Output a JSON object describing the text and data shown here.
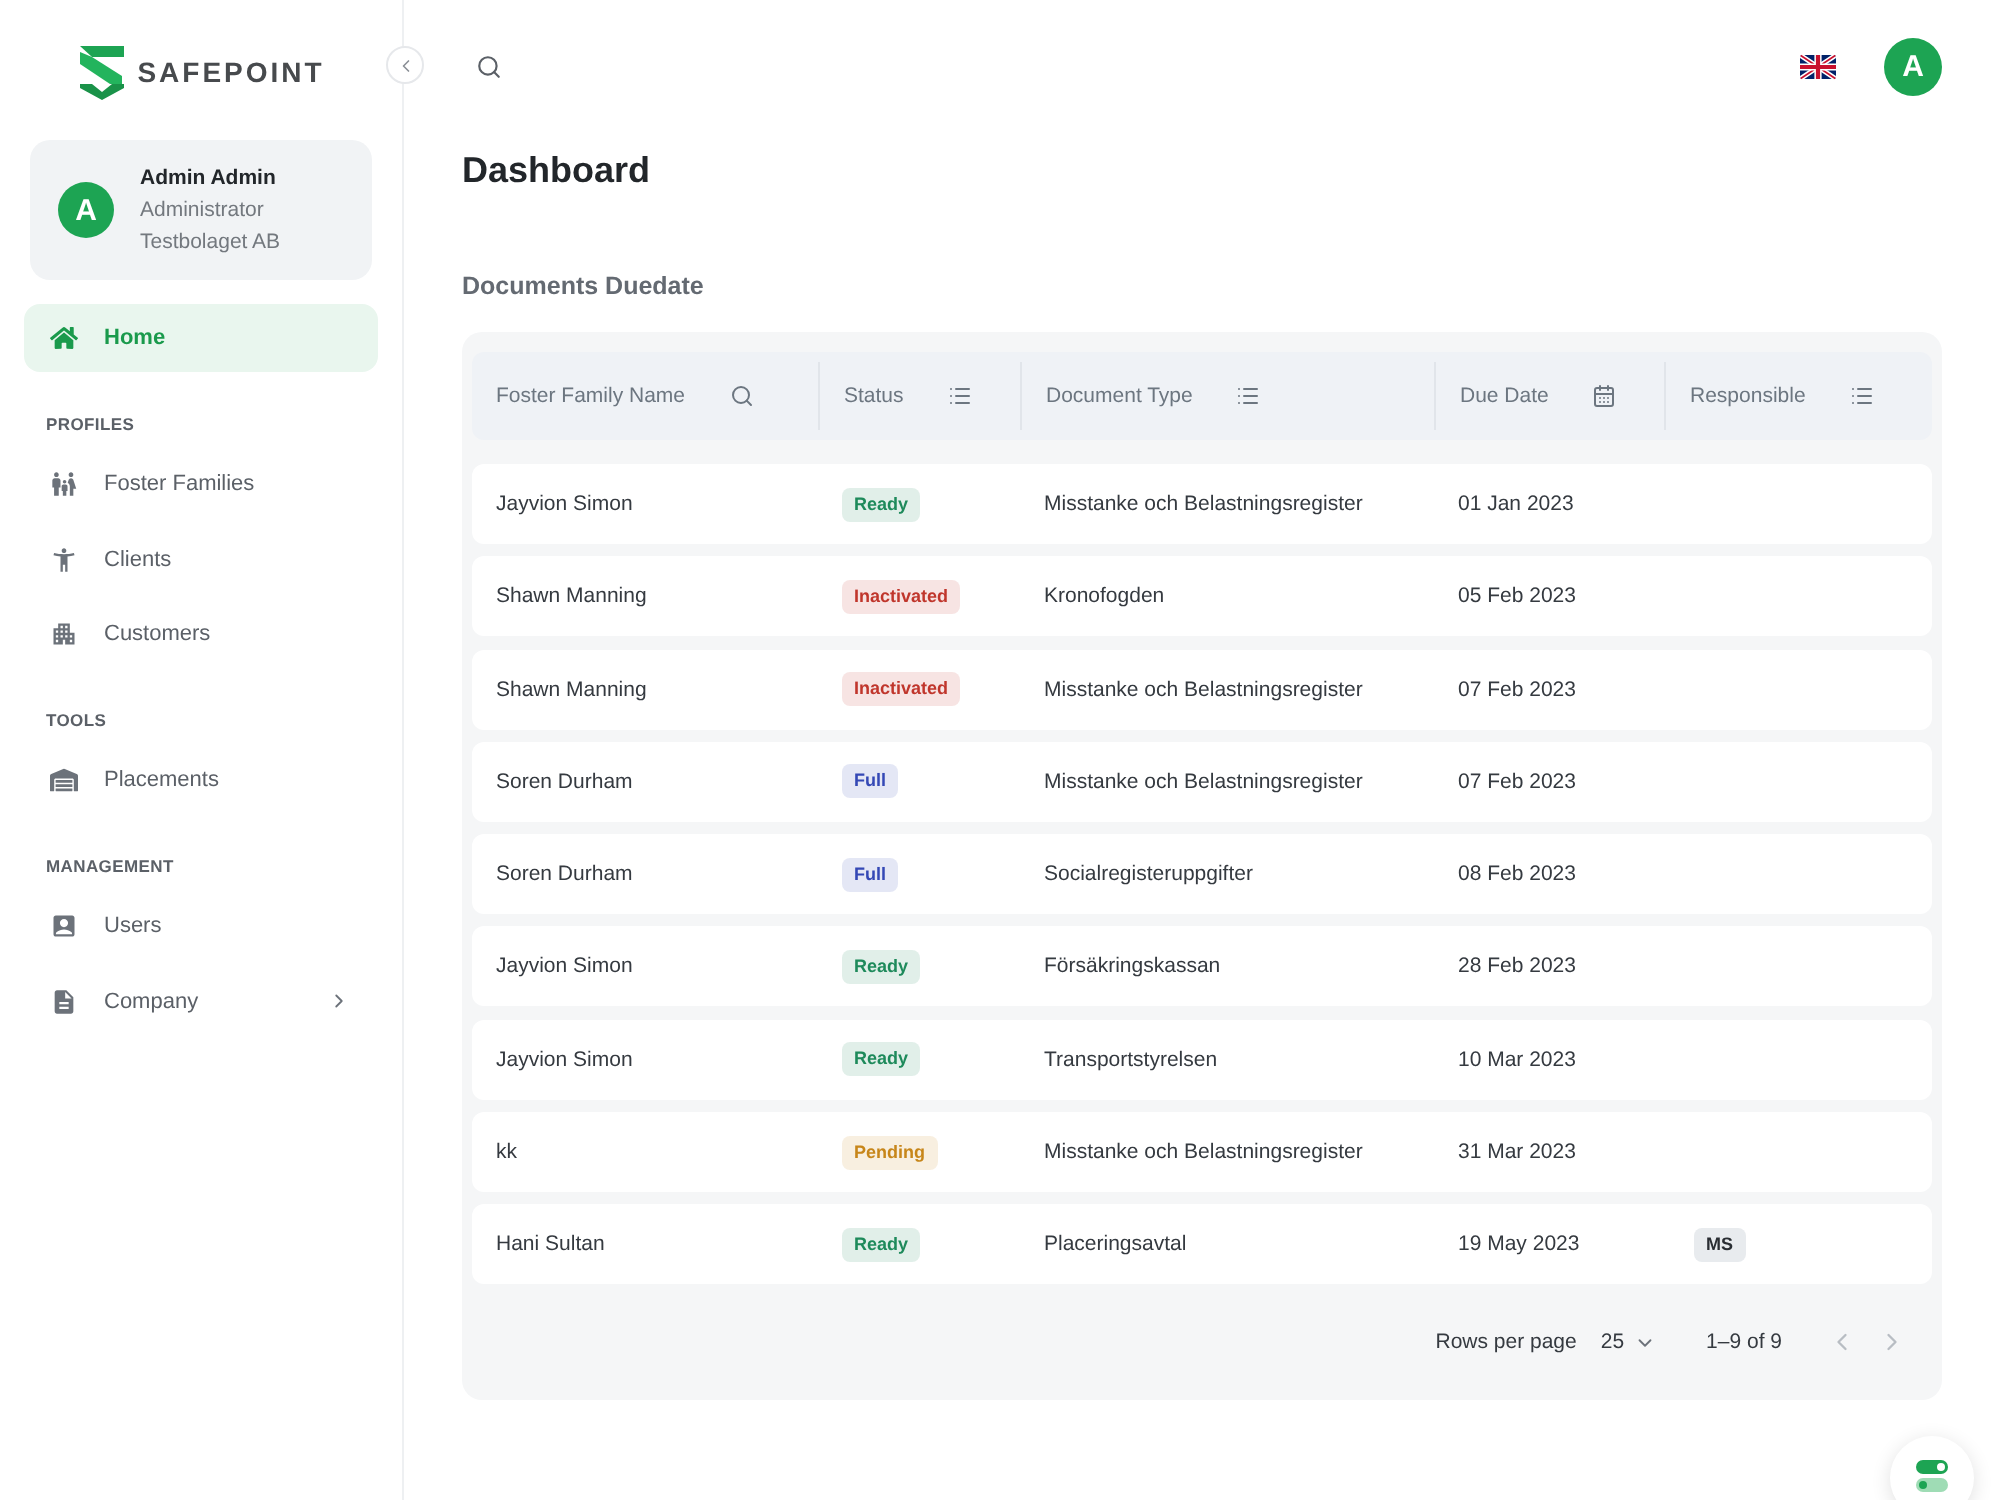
{
  "sidebar": {
    "logo": "SAFEPOINT",
    "user": {
      "initial": "A",
      "name": "Admin Admin",
      "role": "Administrator",
      "company": "Testbolaget AB"
    },
    "nav": [
      {
        "label": "Home",
        "selected": true
      }
    ],
    "sections": [
      {
        "title": "PROFILES",
        "items": [
          {
            "label": "Foster Families",
            "selected": false
          },
          {
            "label": "Clients",
            "selected": false
          },
          {
            "label": "Customers",
            "selected": false
          }
        ]
      },
      {
        "title": "TOOLS",
        "items": [
          {
            "label": "Placements",
            "selected": false
          }
        ]
      },
      {
        "title": "MANAGEMENT",
        "items": [
          {
            "label": "Users",
            "selected": false
          },
          {
            "label": "Company",
            "selected": false,
            "expanded": false
          }
        ]
      }
    ]
  },
  "topbar": {
    "avatar": "A"
  },
  "page": {
    "title": "Dashboard",
    "section_title": "Documents Duedate"
  },
  "table": {
    "columns": [
      "Foster Family Name",
      "Status",
      "Document Type",
      "Due Date",
      "Responsible"
    ],
    "rows": [
      {
        "name": "Jayvion Simon",
        "status": {
          "label": "Ready",
          "color": "#1e8a5b"
        },
        "document_type": "Misstanke och Belastningsregister",
        "due_date": "01 Jan 2023"
      },
      {
        "name": "Shawn Manning",
        "status": {
          "label": "Inactivated",
          "color": "#c0362c"
        },
        "document_type": "Kronofogden",
        "due_date": "05 Feb 2023"
      },
      {
        "name": "Shawn Manning",
        "status": {
          "label": "Inactivated",
          "color": "#c0362c"
        },
        "document_type": "Misstanke och Belastningsregister",
        "due_date": "07 Feb 2023"
      },
      {
        "name": "Soren Durham",
        "status": {
          "label": "Full",
          "color": "#3448b5"
        },
        "document_type": "Misstanke och Belastningsregister",
        "due_date": "07 Feb 2023"
      },
      {
        "name": "Soren Durham",
        "status": {
          "label": "Full",
          "color": "#3448b5"
        },
        "document_type": "Socialregisteruppgifter",
        "due_date": "08 Feb 2023"
      },
      {
        "name": "Jayvion Simon",
        "status": {
          "label": "Ready",
          "color": "#1e8a5b"
        },
        "document_type": "Försäkringskassan",
        "due_date": "28 Feb 2023"
      },
      {
        "name": "Jayvion Simon",
        "status": {
          "label": "Ready",
          "color": "#1e8a5b"
        },
        "document_type": "Transportstyrelsen",
        "due_date": "10 Mar 2023"
      },
      {
        "name": "kk",
        "status": {
          "label": "Pending",
          "color": "#c7861a"
        },
        "document_type": "Misstanke och Belastningsregister",
        "due_date": "31 Mar 2023"
      },
      {
        "name": "Hani Sultan",
        "status": {
          "label": "Ready",
          "color": "#1e8a5b"
        },
        "document_type": "Placeringsavtal",
        "due_date": "19 May 2023",
        "responsible": "MS"
      }
    ],
    "pagination": {
      "rows_per_page_label": "Rows per page",
      "rows_per_page": "25",
      "range": "1–9 of 9",
      "previous": {
        "disabled": true
      },
      "next": {
        "disabled": true
      }
    }
  }
}
